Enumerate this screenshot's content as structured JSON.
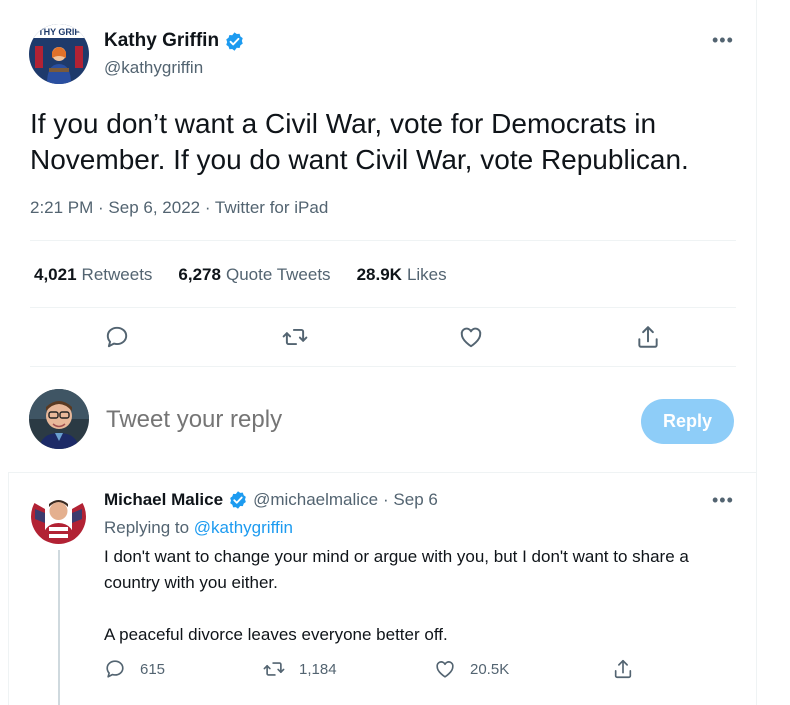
{
  "tweet": {
    "author_name": "Kathy Griffin",
    "author_handle": "@kathygriffin",
    "avatar_sign_text": "THY GRIF",
    "more_label": "•••",
    "text": "If you don’t want a Civil War, vote for Democrats in November. If you do want Civil War, vote Republican.",
    "timestamp": "2:21 PM · Sep 6, 2022 · Twitter for iPad",
    "stats": {
      "retweets_count": "4,021",
      "retweets_label": "Retweets",
      "quote_count": "6,278",
      "quote_label": "Quote Tweets",
      "likes_count": "28.9K",
      "likes_label": "Likes"
    },
    "actions": [
      "reply-icon",
      "retweet-icon",
      "like-icon",
      "share-icon"
    ]
  },
  "composer": {
    "placeholder": "Tweet your reply",
    "button_label": "Reply"
  },
  "reply": {
    "author_name": "Michael Malice",
    "author_handle": "@michaelmalice",
    "date": "· Sep 6",
    "more_label": "•••",
    "replying_prefix": "Replying to",
    "replying_to": "@kathygriffin",
    "paragraph_1": "I don't want to change your mind or argue with you, but I don't want to share a country with you either.",
    "paragraph_2": "A peaceful divorce leaves everyone better off.",
    "reply_count": "615",
    "retweet_count": "1,184",
    "like_count": "20.5K"
  },
  "colors": {
    "accent": "#1d9bf0",
    "muted_text": "#536471",
    "reply_button_disabled": "#8ecdf8",
    "divider": "#eff3f4"
  }
}
